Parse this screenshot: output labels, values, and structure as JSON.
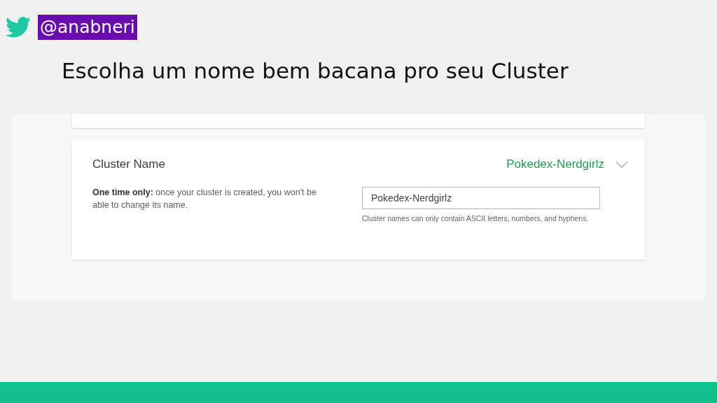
{
  "header": {
    "handle": "@anabneri",
    "title": "Escolha um nome bem bacana pro seu Cluster"
  },
  "screenshot": {
    "section": {
      "title": "Cluster Name",
      "summary": "Pokedex-Nerdgirlz",
      "description": "**One time only:** once your cluster is created, you won't be able to change its name.",
      "input": {
        "value": "Pokedex-Nerdgirlz"
      },
      "hint": "Cluster names can only contain ASCII letters, numbers, and hyphens."
    }
  }
}
